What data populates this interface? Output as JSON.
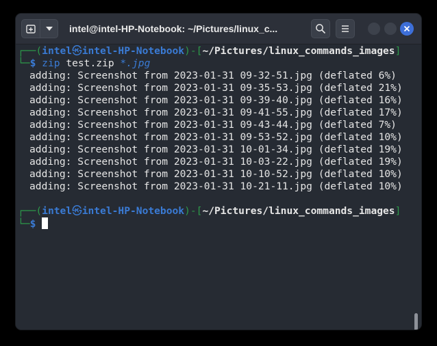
{
  "window": {
    "title": "intel@intel-HP-Notebook: ~/Pictures/linux_c..."
  },
  "colors": {
    "background": "#262b33",
    "prompt_frame": "#2d9a4a",
    "prompt_user": "#3a7bd5",
    "text": "#e6e6e6",
    "close_button": "#3d6fd8"
  },
  "icons": {
    "new_tab": "new-tab-icon",
    "dropdown": "chevron-down-icon",
    "search": "search-icon",
    "menu": "hamburger-menu-icon",
    "minimize": "minimize-icon",
    "maximize": "maximize-icon",
    "close": "close-icon",
    "host_separator": "skull-icon"
  },
  "prompt1": {
    "open": "┌──(",
    "user": "intel",
    "host": "intel-HP-Notebook",
    "mid": ")-[",
    "cwd": "~/Pictures/linux_commands_images",
    "close": "]",
    "corner": "└─",
    "symbol": "$",
    "command": "zip",
    "args": "test.zip",
    "glob": "*.jpg"
  },
  "output": [
    "adding: Screenshot from 2023-01-31 09-32-51.jpg (deflated 6%)",
    "adding: Screenshot from 2023-01-31 09-35-53.jpg (deflated 21%)",
    "adding: Screenshot from 2023-01-31 09-39-40.jpg (deflated 16%)",
    "adding: Screenshot from 2023-01-31 09-41-55.jpg (deflated 17%)",
    "adding: Screenshot from 2023-01-31 09-43-44.jpg (deflated 7%)",
    "adding: Screenshot from 2023-01-31 09-53-52.jpg (deflated 10%)",
    "adding: Screenshot from 2023-01-31 10-01-34.jpg (deflated 19%)",
    "adding: Screenshot from 2023-01-31 10-03-22.jpg (deflated 19%)",
    "adding: Screenshot from 2023-01-31 10-10-52.jpg (deflated 10%)",
    "adding: Screenshot from 2023-01-31 10-21-11.jpg (deflated 10%)"
  ],
  "prompt2": {
    "open": "┌──(",
    "user": "intel",
    "host": "intel-HP-Notebook",
    "mid": ")-[",
    "cwd": "~/Pictures/linux_commands_images",
    "close": "]",
    "corner": "└─",
    "symbol": "$"
  }
}
